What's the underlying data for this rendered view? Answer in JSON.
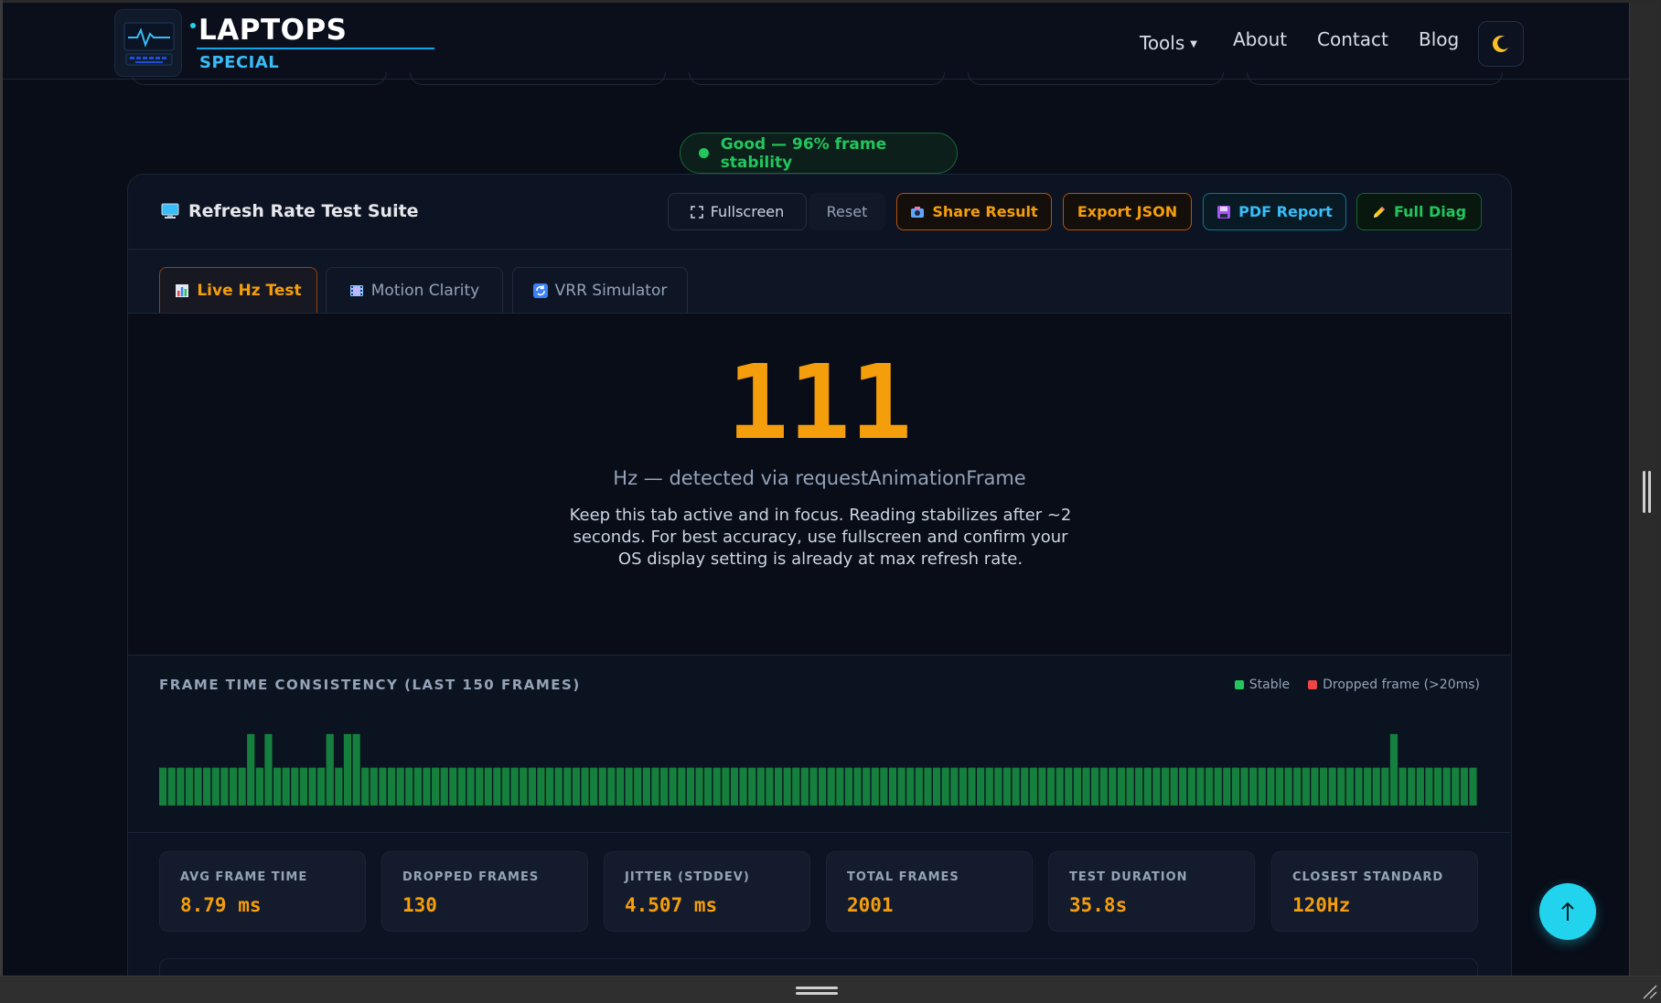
{
  "brand": {
    "title": "LAPTOPS",
    "subtitle": "SPECIAL"
  },
  "nav": {
    "tools": "Tools",
    "about": "About",
    "contact": "Contact",
    "blog": "Blog"
  },
  "status": {
    "text": "Good — 96% frame stability",
    "color": "#22c55e"
  },
  "card": {
    "title": "Refresh Rate Test Suite",
    "buttons": {
      "fullscreen": "Fullscreen",
      "reset": "Reset",
      "share": "Share Result",
      "export": "Export JSON",
      "pdf": "PDF Report",
      "diag": "Full Diag"
    },
    "tabs": [
      {
        "label": "Live Hz Test",
        "active": true
      },
      {
        "label": "Motion Clarity",
        "active": false
      },
      {
        "label": "VRR Simulator",
        "active": false
      }
    ]
  },
  "reading": {
    "hz": "111",
    "caption": "Hz — detected via requestAnimationFrame",
    "help": "Keep this tab active and in focus. Reading stabilizes after ~2 seconds. For best accuracy, use fullscreen and confirm your OS display setting is already at max refresh rate."
  },
  "graph": {
    "title": "FRAME TIME CONSISTENCY (LAST 150 FRAMES)",
    "legend": {
      "stable": "Stable",
      "dropped": "Dropped frame (>20ms)"
    },
    "colors": {
      "stable": "#15803d",
      "dropped": "#ef4444"
    },
    "frame_times_ms": [
      9,
      9,
      9,
      9,
      9,
      9,
      9,
      9,
      9,
      9,
      17,
      9,
      17,
      9,
      9,
      9,
      9,
      9,
      9,
      17,
      9,
      17,
      17,
      9,
      9,
      9,
      9,
      9,
      9,
      9,
      9,
      9,
      9,
      9,
      9,
      9,
      9,
      9,
      9,
      9,
      9,
      9,
      9,
      9,
      9,
      9,
      9,
      9,
      9,
      9,
      9,
      9,
      9,
      9,
      9,
      9,
      9,
      9,
      9,
      9,
      9,
      9,
      9,
      9,
      9,
      9,
      9,
      9,
      9,
      9,
      9,
      9,
      9,
      9,
      9,
      9,
      9,
      9,
      9,
      9,
      9,
      9,
      9,
      9,
      9,
      9,
      9,
      9,
      9,
      9,
      9,
      9,
      9,
      9,
      9,
      9,
      9,
      9,
      9,
      9,
      9,
      9,
      9,
      9,
      9,
      9,
      9,
      9,
      9,
      9,
      9,
      9,
      9,
      9,
      9,
      9,
      9,
      9,
      9,
      9,
      9,
      9,
      9,
      9,
      9,
      9,
      9,
      9,
      9,
      9,
      9,
      9,
      9,
      9,
      9,
      9,
      9,
      9,
      9,
      9,
      17,
      9,
      9,
      9,
      9,
      9,
      9,
      9,
      9,
      9
    ]
  },
  "stats": [
    {
      "label": "AVG FRAME TIME",
      "value": "8.79 ms"
    },
    {
      "label": "DROPPED FRAMES",
      "value": "130"
    },
    {
      "label": "JITTER (STDDEV)",
      "value": "4.507 ms"
    },
    {
      "label": "TOTAL FRAMES",
      "value": "2001"
    },
    {
      "label": "TEST DURATION",
      "value": "35.8s"
    },
    {
      "label": "CLOSEST STANDARD",
      "value": "120Hz"
    }
  ],
  "accent": "#f59e0b"
}
